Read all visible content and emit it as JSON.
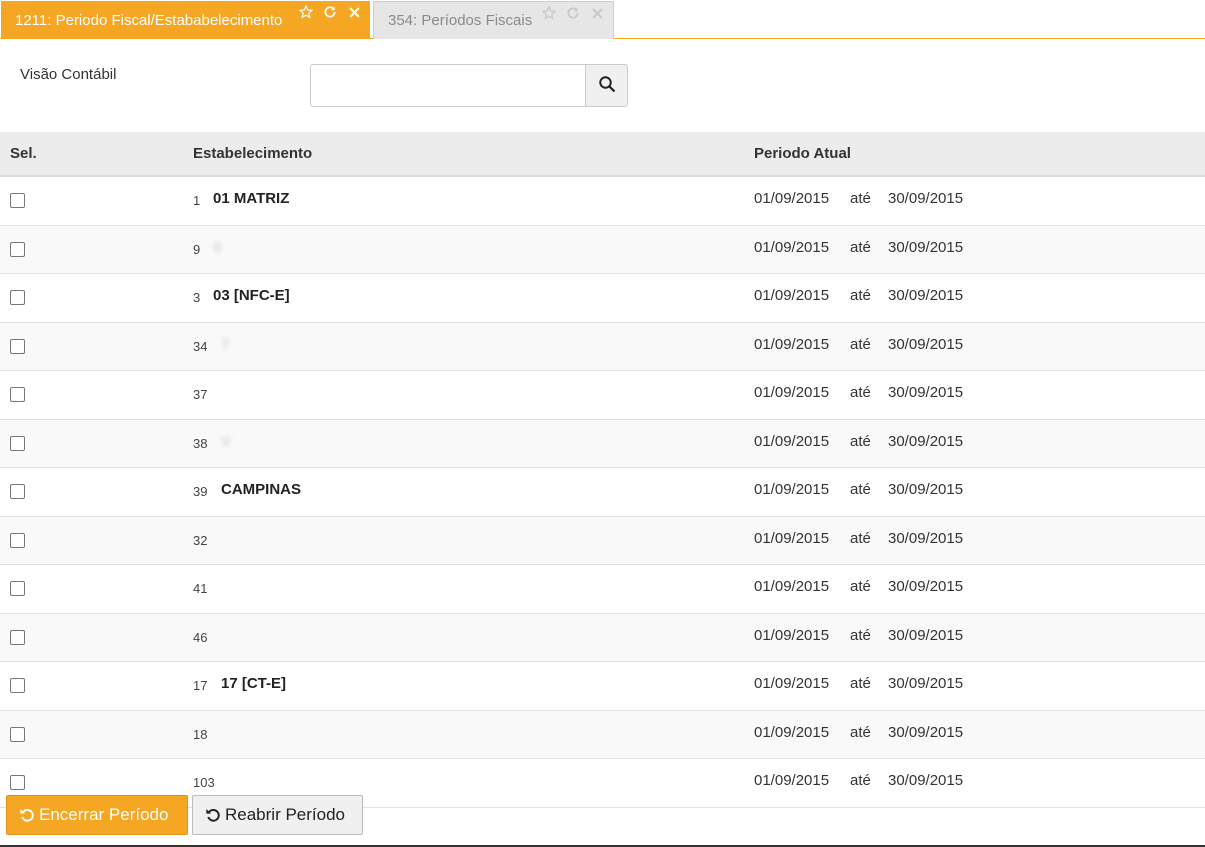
{
  "tabs": [
    {
      "label": "1211: Periodo Fiscal/Estababelecimento",
      "active": true,
      "icons": [
        "star-icon",
        "refresh-icon",
        "close-icon"
      ]
    },
    {
      "label": "354: Períodos Fiscais",
      "active": false,
      "icons": [
        "star-icon",
        "refresh-icon",
        "close-icon"
      ]
    }
  ],
  "filter": {
    "label": "Visão Contábil",
    "value": "",
    "search_icon": "search-icon"
  },
  "table": {
    "headers": {
      "sel": "Sel.",
      "estabelecimento": "Estabelecimento",
      "periodo": "Periodo Atual"
    },
    "rows": [
      {
        "code": "1",
        "name": "01 MATRIZ",
        "start": "01/09/2015",
        "sep": "até",
        "end": "30/09/2015",
        "obscured": false
      },
      {
        "code": "9",
        "name": "0",
        "start": "01/09/2015",
        "sep": "até",
        "end": "30/09/2015",
        "obscured": true
      },
      {
        "code": "3",
        "name": "03 [NFC-E]",
        "start": "01/09/2015",
        "sep": "até",
        "end": "30/09/2015",
        "obscured": false
      },
      {
        "code": "34",
        "name": "7",
        "start": "01/09/2015",
        "sep": "até",
        "end": "30/09/2015",
        "obscured": true
      },
      {
        "code": "37",
        "name": "",
        "start": "01/09/2015",
        "sep": "até",
        "end": "30/09/2015",
        "obscured": true
      },
      {
        "code": "38",
        "name": "V",
        "start": "01/09/2015",
        "sep": "até",
        "end": "30/09/2015",
        "obscured": true
      },
      {
        "code": "39",
        "name": "CAMPINAS",
        "start": "01/09/2015",
        "sep": "até",
        "end": "30/09/2015",
        "obscured": false
      },
      {
        "code": "32",
        "name": "",
        "start": "01/09/2015",
        "sep": "até",
        "end": "30/09/2015",
        "obscured": true
      },
      {
        "code": "41",
        "name": "",
        "start": "01/09/2015",
        "sep": "até",
        "end": "30/09/2015",
        "obscured": true
      },
      {
        "code": "46",
        "name": "",
        "start": "01/09/2015",
        "sep": "até",
        "end": "30/09/2015",
        "obscured": true
      },
      {
        "code": "17",
        "name": "17 [CT-E]",
        "start": "01/09/2015",
        "sep": "até",
        "end": "30/09/2015",
        "obscured": false
      },
      {
        "code": "18",
        "name": "",
        "start": "01/09/2015",
        "sep": "até",
        "end": "30/09/2015",
        "obscured": true
      },
      {
        "code": "103",
        "name": "",
        "start": "01/09/2015",
        "sep": "até",
        "end": "30/09/2015",
        "obscured": true
      }
    ]
  },
  "buttons": {
    "close_period": "Encerrar Período",
    "reopen_period": "Reabrir Período",
    "icon": "undo-icon"
  },
  "colors": {
    "accent": "#f5a623",
    "header_bg": "#ececec",
    "inactive_tab": "#e6e6e6"
  }
}
